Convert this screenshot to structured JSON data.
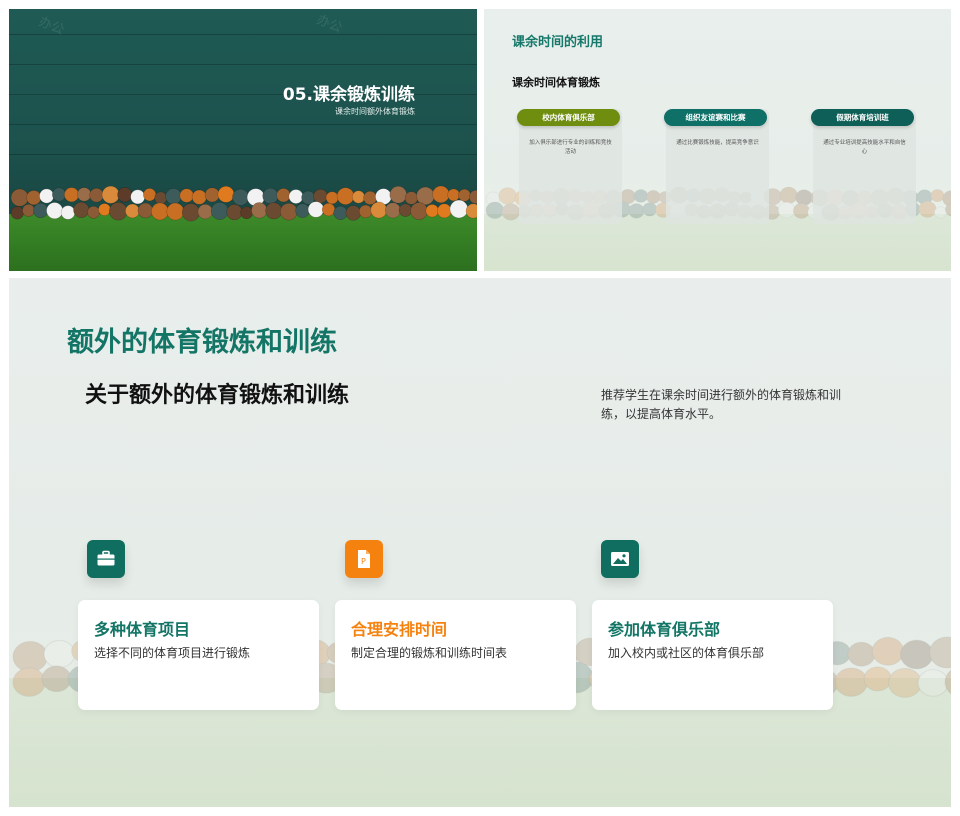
{
  "colors": {
    "teal": "#0f6e60",
    "teal_text": "#15786a",
    "green_pill": "#6f8e10",
    "orange": "#f5820f",
    "board": "#1d524d"
  },
  "slide1": {
    "watermark": "办公",
    "title": "05.课余锻炼训练",
    "subtitle": "课余时间额外体育锻炼"
  },
  "slide2": {
    "heading": "课余时间的利用",
    "subheading": "课余时间体育锻炼",
    "cards": [
      {
        "label": "校内体育俱乐部",
        "desc": "加入俱乐部进行专业的训练和竞技活动"
      },
      {
        "label": "组织友谊赛和比赛",
        "desc": "通过比赛锻炼技能，提高竞争意识"
      },
      {
        "label": "假期体育培训班",
        "desc": "通过专业培训提高技能水平和自信心"
      }
    ]
  },
  "slide3": {
    "heading": "额外的体育锻炼和训练",
    "subheading": "关于额外的体育锻炼和训练",
    "intro": "推荐学生在课余时间进行额外的体育锻炼和训练，以提高体育水平。",
    "features": [
      {
        "icon": "briefcase-icon",
        "title": "多种体育项目",
        "desc": "选择不同的体育项目进行锻炼"
      },
      {
        "icon": "document-icon",
        "title": "合理安排时间",
        "desc": "制定合理的锻炼和训练时间表"
      },
      {
        "icon": "image-icon",
        "title": "参加体育俱乐部",
        "desc": "加入校内或社区的体育俱乐部"
      }
    ]
  }
}
